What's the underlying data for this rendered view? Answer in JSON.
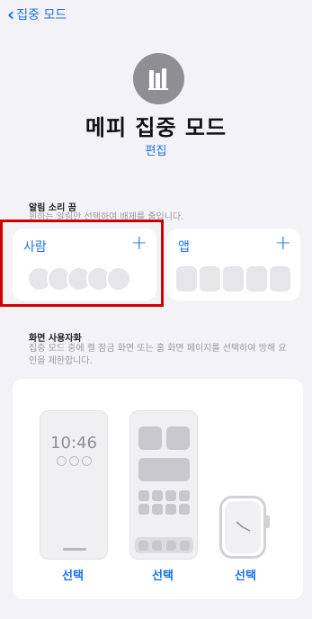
{
  "nav": {
    "back_label": "집중 모드"
  },
  "header": {
    "title": "메피 집중 모드",
    "edit_label": "편집"
  },
  "notifications": {
    "section_title": "알림 소리 끔",
    "section_desc": "원하는 알림만 선택하여 배제를 줄입니다.",
    "people_label": "사람",
    "apps_label": "앱",
    "add_glyph": "+"
  },
  "screen_custom": {
    "section_title": "화면 사용자화",
    "section_desc": "집중 모드 중에 켤 잠금 화면 또는 홈 화면 페이지를 선택하여 방해 요인을 제한합니다.",
    "lock_time": "10:46",
    "select_lock": "선택",
    "select_home": "선택",
    "select_watch": "선택"
  },
  "colors": {
    "accent": "#1a73e8",
    "highlight": "#d10000"
  },
  "icons": [
    "chevron-left-icon",
    "focus-books-icon",
    "plus-icon"
  ]
}
